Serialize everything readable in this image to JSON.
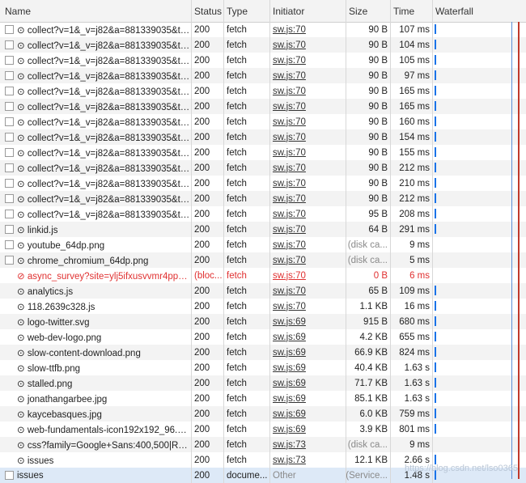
{
  "headers": {
    "name": "Name",
    "status": "Status",
    "type": "Type",
    "initiator": "Initiator",
    "size": "Size",
    "time": "Time",
    "waterfall": "Waterfall"
  },
  "watermark": "https://blog.csdn.net/lso0365",
  "rows": [
    {
      "icon": "checkbox",
      "name": "⊙ collect?v=1&_v=j82&a=881339035&t=...",
      "status": "200",
      "type": "fetch",
      "initiator": "sw.js:70",
      "size": "90 B",
      "time": "107 ms",
      "error": false,
      "bar": true
    },
    {
      "icon": "checkbox",
      "name": "⊙ collect?v=1&_v=j82&a=881339035&t=...",
      "status": "200",
      "type": "fetch",
      "initiator": "sw.js:70",
      "size": "90 B",
      "time": "104 ms",
      "error": false,
      "bar": true
    },
    {
      "icon": "checkbox",
      "name": "⊙ collect?v=1&_v=j82&a=881339035&t=...",
      "status": "200",
      "type": "fetch",
      "initiator": "sw.js:70",
      "size": "90 B",
      "time": "105 ms",
      "error": false,
      "bar": true
    },
    {
      "icon": "checkbox",
      "name": "⊙ collect?v=1&_v=j82&a=881339035&t=...",
      "status": "200",
      "type": "fetch",
      "initiator": "sw.js:70",
      "size": "90 B",
      "time": "97 ms",
      "error": false,
      "bar": true
    },
    {
      "icon": "checkbox",
      "name": "⊙ collect?v=1&_v=j82&a=881339035&t=...",
      "status": "200",
      "type": "fetch",
      "initiator": "sw.js:70",
      "size": "90 B",
      "time": "165 ms",
      "error": false,
      "bar": true
    },
    {
      "icon": "checkbox",
      "name": "⊙ collect?v=1&_v=j82&a=881339035&t=...",
      "status": "200",
      "type": "fetch",
      "initiator": "sw.js:70",
      "size": "90 B",
      "time": "165 ms",
      "error": false,
      "bar": true
    },
    {
      "icon": "checkbox",
      "name": "⊙ collect?v=1&_v=j82&a=881339035&t=...",
      "status": "200",
      "type": "fetch",
      "initiator": "sw.js:70",
      "size": "90 B",
      "time": "160 ms",
      "error": false,
      "bar": true
    },
    {
      "icon": "checkbox",
      "name": "⊙ collect?v=1&_v=j82&a=881339035&t=...",
      "status": "200",
      "type": "fetch",
      "initiator": "sw.js:70",
      "size": "90 B",
      "time": "154 ms",
      "error": false,
      "bar": true
    },
    {
      "icon": "checkbox",
      "name": "⊙ collect?v=1&_v=j82&a=881339035&t=...",
      "status": "200",
      "type": "fetch",
      "initiator": "sw.js:70",
      "size": "90 B",
      "time": "155 ms",
      "error": false,
      "bar": true
    },
    {
      "icon": "checkbox",
      "name": "⊙ collect?v=1&_v=j82&a=881339035&t=...",
      "status": "200",
      "type": "fetch",
      "initiator": "sw.js:70",
      "size": "90 B",
      "time": "212 ms",
      "error": false,
      "bar": true
    },
    {
      "icon": "checkbox",
      "name": "⊙ collect?v=1&_v=j82&a=881339035&t=...",
      "status": "200",
      "type": "fetch",
      "initiator": "sw.js:70",
      "size": "90 B",
      "time": "210 ms",
      "error": false,
      "bar": true
    },
    {
      "icon": "checkbox",
      "name": "⊙ collect?v=1&_v=j82&a=881339035&t=...",
      "status": "200",
      "type": "fetch",
      "initiator": "sw.js:70",
      "size": "90 B",
      "time": "212 ms",
      "error": false,
      "bar": true
    },
    {
      "icon": "checkbox",
      "name": "⊙ collect?v=1&_v=j82&a=881339035&t=...",
      "status": "200",
      "type": "fetch",
      "initiator": "sw.js:70",
      "size": "95 B",
      "time": "208 ms",
      "error": false,
      "bar": true
    },
    {
      "icon": "checkbox",
      "name": "⊙ linkid.js",
      "status": "200",
      "type": "fetch",
      "initiator": "sw.js:70",
      "size": "64 B",
      "time": "291 ms",
      "error": false,
      "bar": true
    },
    {
      "icon": "checkbox",
      "name": "⊙ youtube_64dp.png",
      "status": "200",
      "type": "fetch",
      "initiator": "sw.js:70",
      "size": "(disk ca...",
      "time": "9 ms",
      "error": false,
      "grey": true,
      "bar": false
    },
    {
      "icon": "checkbox",
      "name": "⊙ chrome_chromium_64dp.png",
      "status": "200",
      "type": "fetch",
      "initiator": "sw.js:70",
      "size": "(disk ca...",
      "time": "5 ms",
      "error": false,
      "grey": true,
      "bar": false
    },
    {
      "icon": "none",
      "name": "⊘ async_survey?site=ylj5ifxusvvmr4pp6ae...",
      "status": "(bloc...",
      "type": "fetch",
      "initiator": "sw.js:70",
      "size": "0 B",
      "time": "6 ms",
      "error": true,
      "bar": false
    },
    {
      "icon": "none",
      "name": "⊙ analytics.js",
      "status": "200",
      "type": "fetch",
      "initiator": "sw.js:70",
      "size": "65 B",
      "time": "109 ms",
      "error": false,
      "bar": true
    },
    {
      "icon": "none",
      "name": "⊙ 118.2639c328.js",
      "status": "200",
      "type": "fetch",
      "initiator": "sw.js:70",
      "size": "1.1 KB",
      "time": "16 ms",
      "error": false,
      "bar": true
    },
    {
      "icon": "none",
      "name": "⊙ logo-twitter.svg",
      "status": "200",
      "type": "fetch",
      "initiator": "sw.js:69",
      "size": "915 B",
      "time": "680 ms",
      "error": false,
      "bar": true
    },
    {
      "icon": "none",
      "name": "⊙ web-dev-logo.png",
      "status": "200",
      "type": "fetch",
      "initiator": "sw.js:69",
      "size": "4.2 KB",
      "time": "655 ms",
      "error": false,
      "bar": true
    },
    {
      "icon": "none",
      "name": "⊙ slow-content-download.png",
      "status": "200",
      "type": "fetch",
      "initiator": "sw.js:69",
      "size": "66.9 KB",
      "time": "824 ms",
      "error": false,
      "bar": true
    },
    {
      "icon": "none",
      "name": "⊙ slow-ttfb.png",
      "status": "200",
      "type": "fetch",
      "initiator": "sw.js:69",
      "size": "40.4 KB",
      "time": "1.63 s",
      "error": false,
      "bar": true
    },
    {
      "icon": "none",
      "name": "⊙ stalled.png",
      "status": "200",
      "type": "fetch",
      "initiator": "sw.js:69",
      "size": "71.7 KB",
      "time": "1.63 s",
      "error": false,
      "bar": true
    },
    {
      "icon": "none",
      "name": "⊙ jonathangarbee.jpg",
      "status": "200",
      "type": "fetch",
      "initiator": "sw.js:69",
      "size": "85.1 KB",
      "time": "1.63 s",
      "error": false,
      "bar": true
    },
    {
      "icon": "none",
      "name": "⊙ kaycebasques.jpg",
      "status": "200",
      "type": "fetch",
      "initiator": "sw.js:69",
      "size": "6.0 KB",
      "time": "759 ms",
      "error": false,
      "bar": true
    },
    {
      "icon": "none",
      "name": "⊙ web-fundamentals-icon192x192_96.png",
      "status": "200",
      "type": "fetch",
      "initiator": "sw.js:69",
      "size": "3.9 KB",
      "time": "801 ms",
      "error": false,
      "bar": true
    },
    {
      "icon": "none",
      "name": "⊙ css?family=Google+Sans:400,500|Robo...",
      "status": "200",
      "type": "fetch",
      "initiator": "sw.js:73",
      "size": "(disk ca...",
      "time": "9 ms",
      "error": false,
      "grey": true,
      "bar": false
    },
    {
      "icon": "none",
      "name": "⊙ issues",
      "status": "200",
      "type": "fetch",
      "initiator": "sw.js:73",
      "size": "12.1 KB",
      "time": "2.66 s",
      "error": false,
      "bar": true
    },
    {
      "icon": "doc",
      "name": "issues",
      "status": "200",
      "type": "docume...",
      "initiator": "Other",
      "size": "(Service...",
      "time": "1.48 s",
      "error": false,
      "grey": true,
      "bar": true,
      "selected": true
    }
  ]
}
